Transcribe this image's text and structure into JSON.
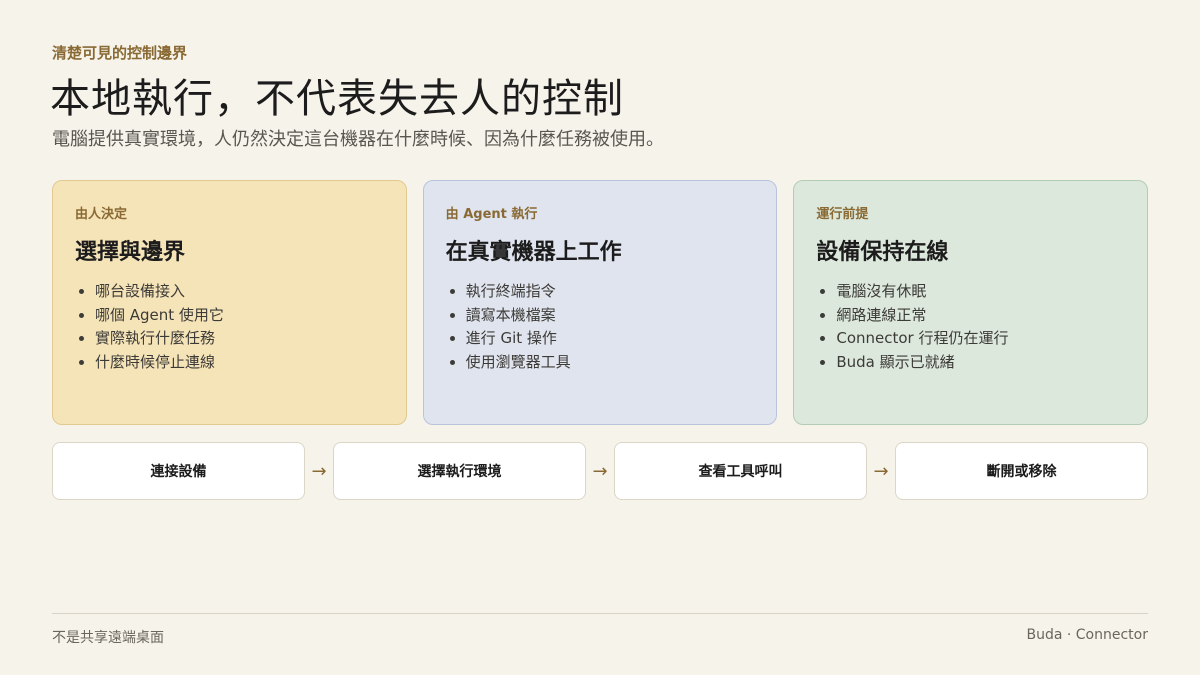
{
  "header": {
    "eyebrow": "清楚可見的控制邊界",
    "title": "本地執行，不代表失去人的控制",
    "subtitle": "電腦提供真實環境，人仍然決定這台機器在什麼時候、因為什麼任務被使用。"
  },
  "cards": [
    {
      "tag": "由人決定",
      "title": "選擇與邊界",
      "items": [
        "哪台設備接入",
        "哪個 Agent 使用它",
        "實際執行什麼任務",
        "什麼時候停止連線"
      ]
    },
    {
      "tag": "由 Agent 執行",
      "title": "在真實機器上工作",
      "items": [
        "執行終端指令",
        "讀寫本機檔案",
        "進行 Git 操作",
        "使用瀏覽器工具"
      ]
    },
    {
      "tag": "運行前提",
      "title": "設備保持在線",
      "items": [
        "電腦沒有休眠",
        "網路連線正常",
        "Connector 行程仍在運行",
        "Buda 顯示已就緒"
      ]
    }
  ],
  "steps": [
    "連接設備",
    "選擇執行環境",
    "查看工具呼叫",
    "斷開或移除"
  ],
  "arrow_glyph": "→",
  "footer": {
    "left": "不是共享遠端桌面",
    "right": "Buda · Connector"
  },
  "colors": {
    "accent": "#8a6a34",
    "card_human": "#f6e4b9",
    "card_agent": "#dfe4ef",
    "card_runtime": "#dce8dc",
    "background": "#f6f3eb"
  }
}
